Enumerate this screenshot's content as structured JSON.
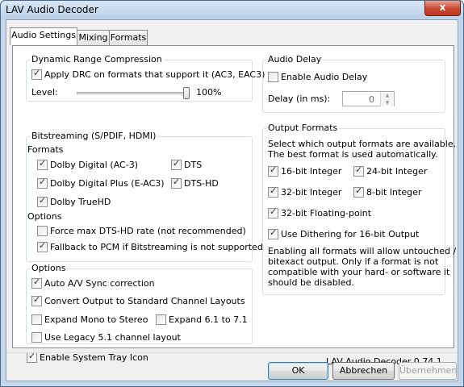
{
  "window": {
    "title": "LAV Audio Decoder",
    "close_label": "x"
  },
  "tabs": [
    {
      "label": "Audio Settings",
      "active": true
    },
    {
      "label": "Mixing",
      "active": false
    },
    {
      "label": "Formats",
      "active": false
    }
  ],
  "drc": {
    "title": "Dynamic Range Compression",
    "apply_label": "Apply DRC on formats that support it (AC3, EAC3)",
    "apply_checked": true,
    "level_label": "Level:",
    "level_value": "100%",
    "level_fraction": 1.0
  },
  "bitstreaming": {
    "title": "Bitstreaming (S/PDIF, HDMI)",
    "formats_heading": "Formats",
    "formats": [
      {
        "label": "Dolby Digital (AC-3)",
        "checked": true
      },
      {
        "label": "DTS",
        "checked": true
      },
      {
        "label": "Dolby Digital Plus (E-AC3)",
        "checked": true
      },
      {
        "label": "DTS-HD",
        "checked": true
      },
      {
        "label": "Dolby TrueHD",
        "checked": true
      }
    ],
    "options_heading": "Options",
    "options": [
      {
        "label": "Force max DTS-HD rate (not recommended)",
        "checked": false
      },
      {
        "label": "Fallback to PCM if Bitstreaming is not supported",
        "checked": true
      }
    ]
  },
  "options": {
    "title": "Options",
    "items": [
      {
        "label": "Auto A/V Sync correction",
        "checked": true
      },
      {
        "label": "Convert Output to Standard Channel Layouts",
        "checked": true
      },
      {
        "label": "Expand Mono to Stereo",
        "checked": false
      },
      {
        "label": "Expand 6.1 to 7.1",
        "checked": false
      },
      {
        "label": "Use Legacy 5.1 channel layout",
        "checked": false
      }
    ]
  },
  "audio_delay": {
    "title": "Audio Delay",
    "enable_label": "Enable Audio Delay",
    "enable_checked": false,
    "delay_label": "Delay (in ms):",
    "delay_value": "0"
  },
  "output_formats": {
    "title": "Output Formats",
    "description": [
      "Select which output formats are available.",
      "The best format is used automatically."
    ],
    "items": [
      {
        "label": "16-bit Integer",
        "checked": true
      },
      {
        "label": "24-bit Integer",
        "checked": true
      },
      {
        "label": "32-bit Integer",
        "checked": true
      },
      {
        "label": "8-bit Integer",
        "checked": true
      },
      {
        "label": "32-bit Floating-point",
        "checked": true
      }
    ],
    "dither_label": "Use Dithering for 16-bit Output",
    "dither_checked": true,
    "note": [
      "Enabling all formats will allow untouched /",
      "bitexact output. Only if a format is not",
      "compatible with your hard- or software it",
      "should be disabled."
    ]
  },
  "tray": {
    "label": "Enable System Tray Icon",
    "checked": true
  },
  "version": "LAV Audio Decoder 0.74.1",
  "buttons": {
    "ok": "OK",
    "cancel": "Abbrechen",
    "apply": "Übernehmen"
  }
}
